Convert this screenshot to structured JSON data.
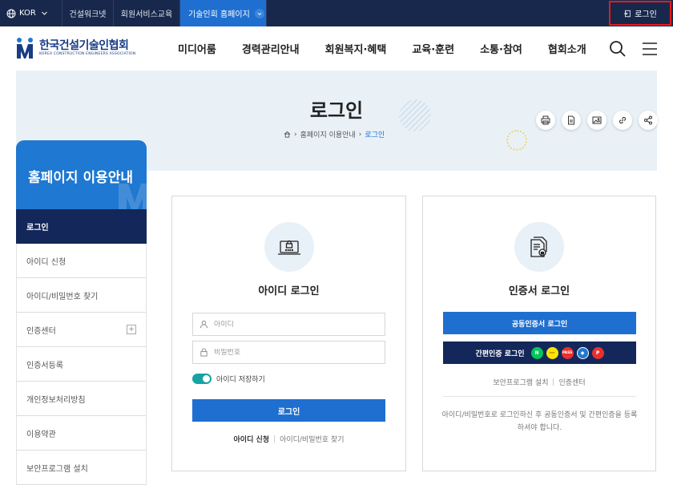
{
  "topbar": {
    "lang": "KOR",
    "links": [
      {
        "label": "건설워크넷",
        "active": false
      },
      {
        "label": "회원서비스교육",
        "active": false
      },
      {
        "label": "기술인회 홈페이지",
        "active": true
      }
    ],
    "login": "로그인"
  },
  "header": {
    "logo_ko": "한국건설기술인협회",
    "logo_en": "KOREA CONSTRUCTION ENGINEERS ASSOCIATION",
    "gnb": [
      "미디어룸",
      "경력관리안내",
      "회원복지·혜택",
      "교육·훈련",
      "소통·참여",
      "협회소개"
    ]
  },
  "page": {
    "title": "로그인",
    "breadcrumb": [
      "홈페이지 이용안내",
      "로그인"
    ]
  },
  "lnb": {
    "title": "홈페이지 이용안내",
    "items": [
      {
        "label": "로그인",
        "active": true
      },
      {
        "label": "아이디 신청"
      },
      {
        "label": "아이디/비밀번호 찾기"
      },
      {
        "label": "인증센터",
        "expandable": true
      },
      {
        "label": "인증서등록"
      },
      {
        "label": "개인정보처리방침"
      },
      {
        "label": "이용약관"
      },
      {
        "label": "보안프로그램 설치"
      }
    ]
  },
  "id_login": {
    "title": "아이디 로그인",
    "id_placeholder": "아이디",
    "pw_placeholder": "비밀번호",
    "save_id": "아이디 저장하기",
    "save_id_on": true,
    "button": "로그인",
    "link_signup": "아이디 신청",
    "link_find": "아이디/비밀번호 찾기"
  },
  "cert_login": {
    "title": "인증서 로그인",
    "joint_cert_button": "공동인증서 로그인",
    "simple_cert_button": "간편인증 로그인",
    "providers": [
      {
        "label": "N",
        "color": "#03c75a"
      },
      {
        "label": "···",
        "color": "#ffe400"
      },
      {
        "label": "PASS",
        "color": "#e8302f"
      },
      {
        "label": "◆",
        "color": "#1f78d1"
      },
      {
        "label": "P",
        "color": "#e8302f"
      }
    ],
    "link_security": "보안프로그램 설치",
    "link_center": "인증센터",
    "notice": "아이디/비밀번호로 로그인하신 후 공동인증서 및 간편인증을 등록하셔야 합니다."
  },
  "colors": {
    "navy": "#17284c",
    "primary": "#1f6fd0",
    "highlight_border": "#e51b1b"
  }
}
